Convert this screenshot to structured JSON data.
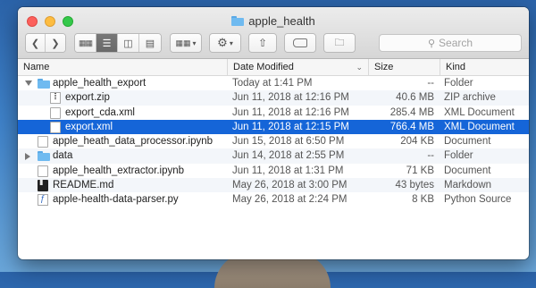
{
  "window": {
    "title": "apple_health"
  },
  "toolbar": {
    "search_placeholder": "Search",
    "active_view": "list"
  },
  "columns": {
    "name": "Name",
    "date": "Date Modified",
    "size": "Size",
    "kind": "Kind"
  },
  "files": [
    {
      "name": "apple_health_export",
      "date": "Today at 1:41 PM",
      "size": "--",
      "kind": "Folder",
      "icon": "folder-icon",
      "level": 0,
      "disclosure": "open"
    },
    {
      "name": "export.zip",
      "date": "Jun 11, 2018 at 12:16 PM",
      "size": "40.6 MB",
      "kind": "ZIP archive",
      "icon": "zip-icon",
      "level": 1
    },
    {
      "name": "export_cda.xml",
      "date": "Jun 11, 2018 at 12:16 PM",
      "size": "285.4 MB",
      "kind": "XML Document",
      "icon": "document-icon",
      "level": 1
    },
    {
      "name": "export.xml",
      "date": "Jun 11, 2018 at 12:15 PM",
      "size": "766.4 MB",
      "kind": "XML Document",
      "icon": "document-icon",
      "level": 1,
      "selected": true
    },
    {
      "name": "apple_heath_data_processor.ipynb",
      "date": "Jun 15, 2018 at 6:50 PM",
      "size": "204 KB",
      "kind": "Document",
      "icon": "document-icon",
      "level": 0
    },
    {
      "name": "data",
      "date": "Jun 14, 2018 at 2:55 PM",
      "size": "--",
      "kind": "Folder",
      "icon": "folder-icon",
      "level": 0,
      "disclosure": "closed"
    },
    {
      "name": "apple_health_extractor.ipynb",
      "date": "Jun 11, 2018 at 1:31 PM",
      "size": "71 KB",
      "kind": "Document",
      "icon": "document-icon",
      "level": 0
    },
    {
      "name": "README.md",
      "date": "May 26, 2018 at 3:00 PM",
      "size": "43 bytes",
      "kind": "Markdown",
      "icon": "terminal-icon",
      "level": 0
    },
    {
      "name": "apple-health-data-parser.py",
      "date": "May 26, 2018 at 2:24 PM",
      "size": "8 KB",
      "kind": "Python Source",
      "icon": "python-file-icon",
      "level": 0
    }
  ],
  "colors": {
    "selection": "#1565d8",
    "folder": "#6fbaf0"
  }
}
